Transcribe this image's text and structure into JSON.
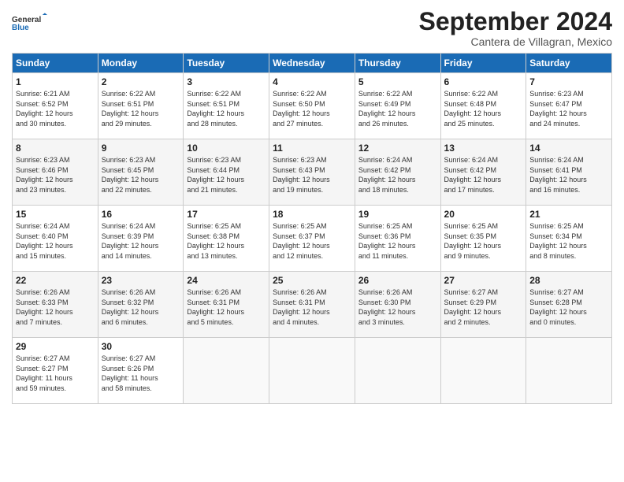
{
  "header": {
    "logo_line1": "General",
    "logo_line2": "Blue",
    "month_title": "September 2024",
    "subtitle": "Cantera de Villagran, Mexico"
  },
  "days_of_week": [
    "Sunday",
    "Monday",
    "Tuesday",
    "Wednesday",
    "Thursday",
    "Friday",
    "Saturday"
  ],
  "weeks": [
    [
      {
        "day": "1",
        "info": "Sunrise: 6:21 AM\nSunset: 6:52 PM\nDaylight: 12 hours\nand 30 minutes."
      },
      {
        "day": "2",
        "info": "Sunrise: 6:22 AM\nSunset: 6:51 PM\nDaylight: 12 hours\nand 29 minutes."
      },
      {
        "day": "3",
        "info": "Sunrise: 6:22 AM\nSunset: 6:51 PM\nDaylight: 12 hours\nand 28 minutes."
      },
      {
        "day": "4",
        "info": "Sunrise: 6:22 AM\nSunset: 6:50 PM\nDaylight: 12 hours\nand 27 minutes."
      },
      {
        "day": "5",
        "info": "Sunrise: 6:22 AM\nSunset: 6:49 PM\nDaylight: 12 hours\nand 26 minutes."
      },
      {
        "day": "6",
        "info": "Sunrise: 6:22 AM\nSunset: 6:48 PM\nDaylight: 12 hours\nand 25 minutes."
      },
      {
        "day": "7",
        "info": "Sunrise: 6:23 AM\nSunset: 6:47 PM\nDaylight: 12 hours\nand 24 minutes."
      }
    ],
    [
      {
        "day": "8",
        "info": "Sunrise: 6:23 AM\nSunset: 6:46 PM\nDaylight: 12 hours\nand 23 minutes."
      },
      {
        "day": "9",
        "info": "Sunrise: 6:23 AM\nSunset: 6:45 PM\nDaylight: 12 hours\nand 22 minutes."
      },
      {
        "day": "10",
        "info": "Sunrise: 6:23 AM\nSunset: 6:44 PM\nDaylight: 12 hours\nand 21 minutes."
      },
      {
        "day": "11",
        "info": "Sunrise: 6:23 AM\nSunset: 6:43 PM\nDaylight: 12 hours\nand 19 minutes."
      },
      {
        "day": "12",
        "info": "Sunrise: 6:24 AM\nSunset: 6:42 PM\nDaylight: 12 hours\nand 18 minutes."
      },
      {
        "day": "13",
        "info": "Sunrise: 6:24 AM\nSunset: 6:42 PM\nDaylight: 12 hours\nand 17 minutes."
      },
      {
        "day": "14",
        "info": "Sunrise: 6:24 AM\nSunset: 6:41 PM\nDaylight: 12 hours\nand 16 minutes."
      }
    ],
    [
      {
        "day": "15",
        "info": "Sunrise: 6:24 AM\nSunset: 6:40 PM\nDaylight: 12 hours\nand 15 minutes."
      },
      {
        "day": "16",
        "info": "Sunrise: 6:24 AM\nSunset: 6:39 PM\nDaylight: 12 hours\nand 14 minutes."
      },
      {
        "day": "17",
        "info": "Sunrise: 6:25 AM\nSunset: 6:38 PM\nDaylight: 12 hours\nand 13 minutes."
      },
      {
        "day": "18",
        "info": "Sunrise: 6:25 AM\nSunset: 6:37 PM\nDaylight: 12 hours\nand 12 minutes."
      },
      {
        "day": "19",
        "info": "Sunrise: 6:25 AM\nSunset: 6:36 PM\nDaylight: 12 hours\nand 11 minutes."
      },
      {
        "day": "20",
        "info": "Sunrise: 6:25 AM\nSunset: 6:35 PM\nDaylight: 12 hours\nand 9 minutes."
      },
      {
        "day": "21",
        "info": "Sunrise: 6:25 AM\nSunset: 6:34 PM\nDaylight: 12 hours\nand 8 minutes."
      }
    ],
    [
      {
        "day": "22",
        "info": "Sunrise: 6:26 AM\nSunset: 6:33 PM\nDaylight: 12 hours\nand 7 minutes."
      },
      {
        "day": "23",
        "info": "Sunrise: 6:26 AM\nSunset: 6:32 PM\nDaylight: 12 hours\nand 6 minutes."
      },
      {
        "day": "24",
        "info": "Sunrise: 6:26 AM\nSunset: 6:31 PM\nDaylight: 12 hours\nand 5 minutes."
      },
      {
        "day": "25",
        "info": "Sunrise: 6:26 AM\nSunset: 6:31 PM\nDaylight: 12 hours\nand 4 minutes."
      },
      {
        "day": "26",
        "info": "Sunrise: 6:26 AM\nSunset: 6:30 PM\nDaylight: 12 hours\nand 3 minutes."
      },
      {
        "day": "27",
        "info": "Sunrise: 6:27 AM\nSunset: 6:29 PM\nDaylight: 12 hours\nand 2 minutes."
      },
      {
        "day": "28",
        "info": "Sunrise: 6:27 AM\nSunset: 6:28 PM\nDaylight: 12 hours\nand 0 minutes."
      }
    ],
    [
      {
        "day": "29",
        "info": "Sunrise: 6:27 AM\nSunset: 6:27 PM\nDaylight: 11 hours\nand 59 minutes."
      },
      {
        "day": "30",
        "info": "Sunrise: 6:27 AM\nSunset: 6:26 PM\nDaylight: 11 hours\nand 58 minutes."
      },
      {
        "day": "",
        "info": ""
      },
      {
        "day": "",
        "info": ""
      },
      {
        "day": "",
        "info": ""
      },
      {
        "day": "",
        "info": ""
      },
      {
        "day": "",
        "info": ""
      }
    ]
  ]
}
